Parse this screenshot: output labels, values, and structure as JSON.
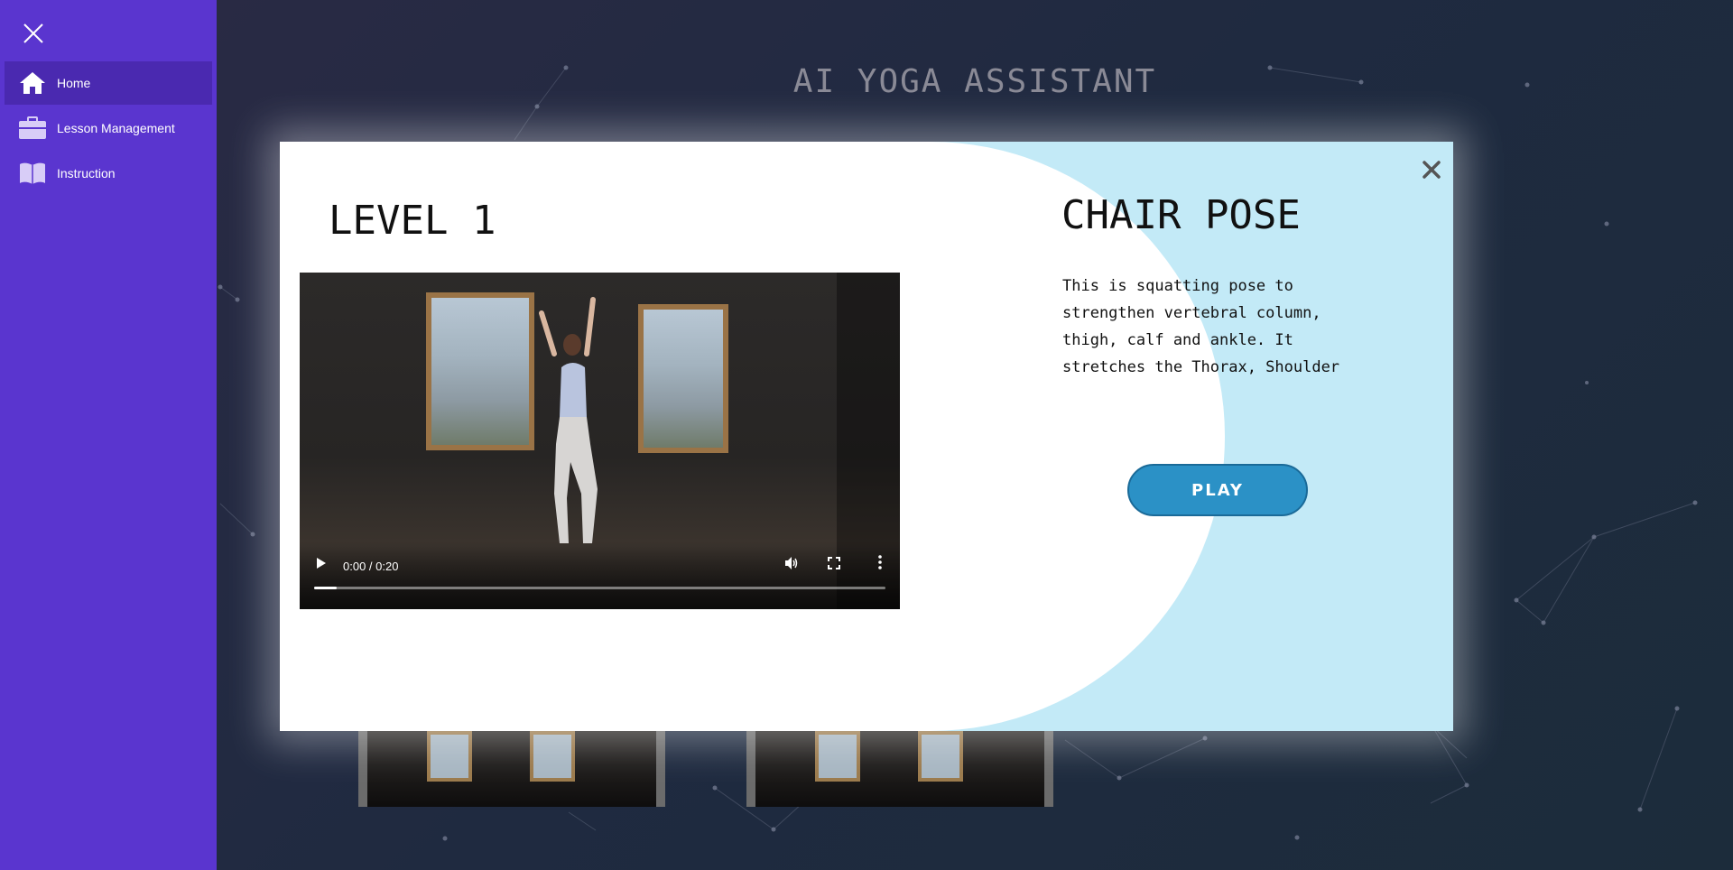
{
  "app": {
    "page_title": "AI YOGA ASSISTANT"
  },
  "sidebar": {
    "close_icon": "close-icon",
    "items": [
      {
        "label": "Home",
        "icon": "home-icon",
        "active": true
      },
      {
        "label": "Lesson Management",
        "icon": "briefcase-icon",
        "active": false
      },
      {
        "label": "Instruction",
        "icon": "book-icon",
        "active": false
      }
    ]
  },
  "modal": {
    "level_title": "LEVEL 1",
    "pose_title": "CHAIR POSE",
    "description": "This is squatting pose to\nstrengthen vertebral column,\nthigh, calf and ankle. It\nstretches the Thorax, Shoulder",
    "play_label": "PLAY",
    "video": {
      "time_display": "0:00 / 0:20",
      "progress": 0.04
    }
  },
  "colors": {
    "sidebar": "#5a35cf",
    "sidebar_active": "#4a29b0",
    "modal_right": "#c3eaf7",
    "play_button": "#2b91c6"
  }
}
